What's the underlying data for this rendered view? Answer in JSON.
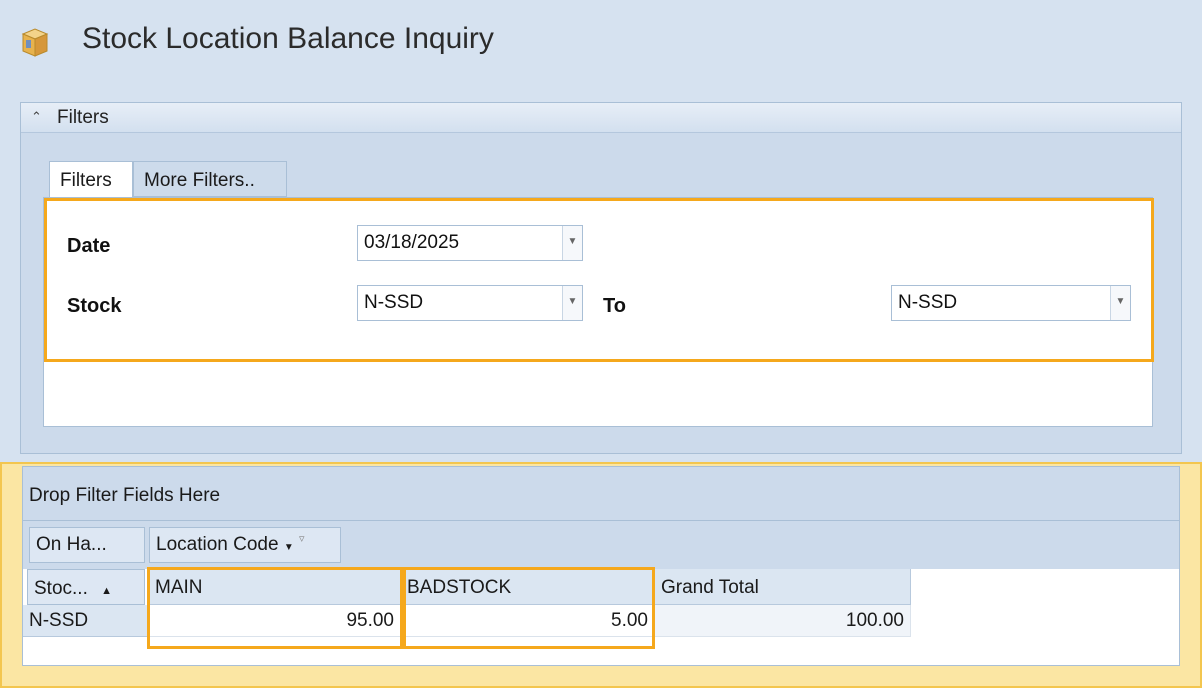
{
  "page": {
    "title": "Stock Location Balance Inquiry",
    "icon": "box-icon",
    "accent_color": "#f5a81c"
  },
  "filters_group": {
    "header_label": "Filters",
    "tabs": [
      {
        "label": "Filters",
        "active": true
      },
      {
        "label": "More Filters.."
      }
    ],
    "date": {
      "label": "Date",
      "value": "03/18/2025"
    },
    "stock": {
      "label": "Stock",
      "from_value": "N-SSD",
      "to_label": "To",
      "to_value": "N-SSD"
    }
  },
  "pivot": {
    "drop_area_label": "Drop Filter Fields Here",
    "data_field": "On Ha...",
    "column_field": "Location Code",
    "row_field": "Stoc...",
    "columns": [
      "MAIN",
      "BADSTOCK",
      "Grand Total"
    ],
    "rows": [
      {
        "label": "N-SSD",
        "values": [
          "95.00",
          "5.00",
          "100.00"
        ]
      }
    ]
  }
}
